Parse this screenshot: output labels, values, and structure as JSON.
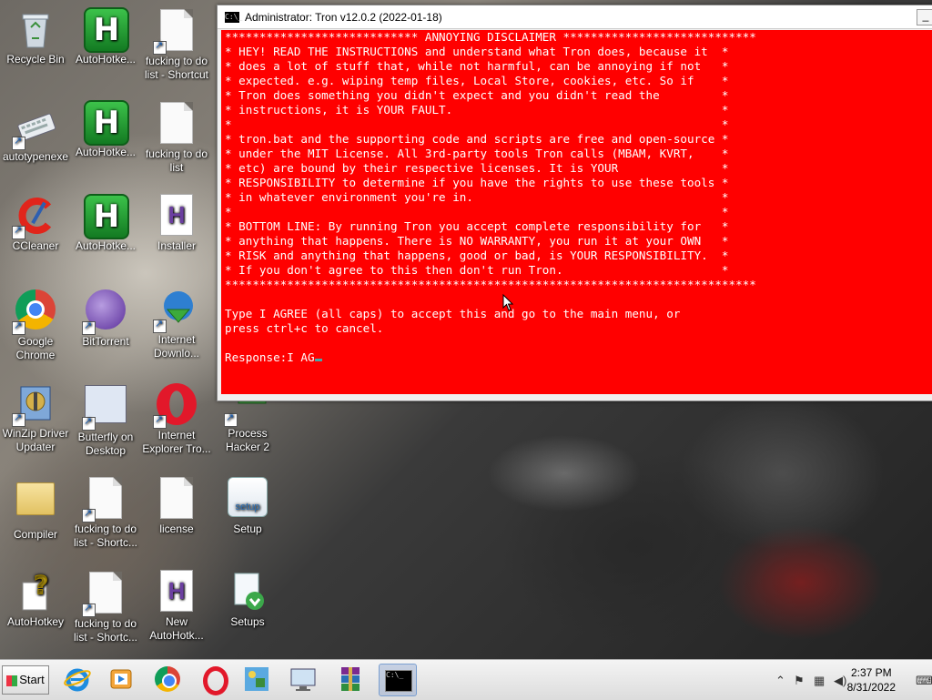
{
  "window": {
    "title": "Administrator:  Tron v12.0.2 (2022-01-18)",
    "console_lines": [
      "**************************** ANNOYING DISCLAIMER ****************************",
      "* HEY! READ THE INSTRUCTIONS and understand what Tron does, because it  *",
      "* does a lot of stuff that, while not harmful, can be annoying if not   *",
      "* expected. e.g. wiping temp files, Local Store, cookies, etc. So if    *",
      "* Tron does something you didn't expect and you didn't read the         *",
      "* instructions, it is YOUR FAULT.                                       *",
      "*                                                                       *",
      "* tron.bat and the supporting code and scripts are free and open-source *",
      "* under the MIT License. All 3rd-party tools Tron calls (MBAM, KVRT,    *",
      "* etc) are bound by their respective licenses. It is YOUR               *",
      "* RESPONSIBILITY to determine if you have the rights to use these tools *",
      "* in whatever environment you're in.                                    *",
      "*                                                                       *",
      "* BOTTOM LINE: By running Tron you accept complete responsibility for   *",
      "* anything that happens. There is NO WARRANTY, you run it at your OWN   *",
      "* RISK and anything that happens, good or bad, is YOUR RESPONSIBILITY.  *",
      "* If you don't agree to this then don't run Tron.                       *",
      "*****************************************************************************"
    ],
    "prompt_line1": "Type I AGREE (all caps) to accept this and go to the main menu, or",
    "prompt_line2": "press ctrl+c to cancel.",
    "response_label": "Response:",
    "response_value": "I AG",
    "minimize_glyph": "_",
    "cmd_icon_text": "C:\\_"
  },
  "desktop_icons": [
    {
      "label": "Recycle Bin",
      "icon": "recycle-bin-icon"
    },
    {
      "label": "AutoHotke...",
      "icon": "autohotkey-icon"
    },
    {
      "label": "fucking to do list - Shortcut",
      "icon": "text-file-icon"
    },
    {
      "label": "autotypenexe",
      "icon": "keyboard-icon"
    },
    {
      "label": "AutoHotke...",
      "icon": "autohotkey-icon"
    },
    {
      "label": "fucking to do list",
      "icon": "text-file-icon"
    },
    {
      "label": "CCleaner",
      "icon": "ccleaner-icon"
    },
    {
      "label": "AutoHotke...",
      "icon": "autohotkey-icon"
    },
    {
      "label": "Installer",
      "icon": "ahk-file-icon"
    },
    {
      "label": "Google Chrome",
      "icon": "chrome-icon"
    },
    {
      "label": "BitTorrent",
      "icon": "bittorrent-icon"
    },
    {
      "label": "Internet Downlo...",
      "icon": "idm-icon"
    },
    {
      "label": "WinZip Driver Updater",
      "icon": "winzip-icon"
    },
    {
      "label": "Butterfly on Desktop",
      "icon": "butterfly-app-icon"
    },
    {
      "label": "Internet Explorer Tro...",
      "icon": "opera-icon"
    },
    {
      "label": "Process Hacker 2",
      "icon": "process-hacker-icon"
    },
    {
      "label": "Compiler",
      "icon": "folder-icon"
    },
    {
      "label": "fucking to do list - Shortc...",
      "icon": "text-file-icon"
    },
    {
      "label": "license",
      "icon": "text-file-icon"
    },
    {
      "label": "Setup",
      "icon": "setup-icon"
    },
    {
      "label": "AutoHotkey",
      "icon": "help-file-icon"
    },
    {
      "label": "fucking to do list - Shortc...",
      "icon": "text-file-icon"
    },
    {
      "label": "New AutoHotk...",
      "icon": "ahk-file-icon"
    },
    {
      "label": "Setups",
      "icon": "setups-icon"
    }
  ],
  "setup_icon_text": "setup",
  "ahk_letter": "H",
  "taskbar": {
    "start_label": "Start",
    "pinned": [
      "internet-explorer-icon",
      "media-player-icon",
      "chrome-icon",
      "opera-icon",
      "network-icon",
      "remote-desktop-icon",
      "winrar-icon",
      "cmd-icon"
    ],
    "time": "2:37 PM",
    "date": "8/31/2022",
    "tray_icons": [
      "show-hidden-icons",
      "flag-icon",
      "network-icon",
      "volume-icon",
      "keyboard-layout-icon"
    ]
  }
}
